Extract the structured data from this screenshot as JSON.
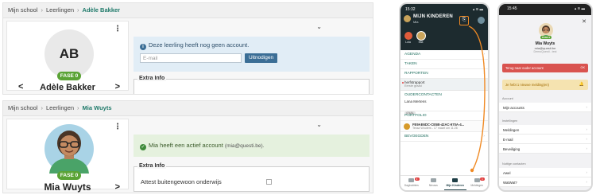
{
  "top_panel": {
    "breadcrumb": [
      "Mijn school",
      "Leerlingen",
      "Adèle Bakker"
    ],
    "initials": "AB",
    "fase": "FASE 0",
    "name": "Adèle Bakker",
    "prev": "<",
    "next": ">",
    "menu": "⋮",
    "collapse": "⌄",
    "alert_text": "Deze leerling heeft nog geen account.",
    "email_placeholder": "E-mail",
    "invite_label": "Uitnodigen",
    "extra_info": "Extra Info"
  },
  "bottom_panel": {
    "breadcrumb": [
      "Mijn school",
      "Leerlingen",
      "Mia Wuyts"
    ],
    "fase": "FASE 0",
    "name": "Mia Wuyts",
    "prev": "<",
    "next": ">",
    "menu": "⋮",
    "collapse": "⌄",
    "alert_text": "Mia heeft een actief account",
    "alert_email": "(mia@questi.be).",
    "extra_info": "Extra Info",
    "row_label": "Attest buitengewoon onderwijs"
  },
  "phone1": {
    "time": "15:32",
    "status": "▴ ≋ ▬",
    "title": "MIJN KINDEREN",
    "subtitle": "Mia",
    "edit_glyph": "⎘",
    "kids": [
      {
        "label": "Lola",
        "color": "#e15b3a"
      },
      {
        "label": "Mia",
        "color": "#c9a45b"
      }
    ],
    "chevron": "›",
    "items": [
      "AGENDA",
      "TAKEN",
      "RAPPORTEN"
    ],
    "report_item": {
      "title": "herfstrapport",
      "meta": "Eerste graad"
    },
    "contacts_header": "OUDERCONTACTEN",
    "contact_name": "Lana Mertens",
    "contact_tag": "4 NAL",
    "portfolio_header": "PORTFOLIO",
    "doc_title": "FE9AE6DC-CE5B-42AC-970A-4...",
    "doc_meta": "Tessa Wouters - 17 maart om 11:26",
    "bottom_item": "BEVOEGDEN",
    "tabs": [
      {
        "label": "Dagbubbles",
        "badge": "3"
      },
      {
        "label": "Nieuws",
        "badge": ""
      },
      {
        "label": "Mijn Kinderen",
        "badge": ""
      },
      {
        "label": "Meldingen",
        "badge": "1"
      }
    ]
  },
  "phone2": {
    "time": "15:45",
    "status": "▴ ≋ ▬",
    "close": "✕",
    "fase": "FASE 0",
    "name": "Mia Wuyts",
    "email": "mia@questi.be",
    "school": "DemoQuesti - test",
    "red_banner": "Terug naar ouder account",
    "red_badge": "OK",
    "yellow_banner": "Je hebt 1 nieuwe melding(en)",
    "bell": "🔔",
    "chevron": "›",
    "sections": [
      {
        "title": "Account",
        "rows": [
          "Mijn accounts"
        ]
      },
      {
        "title": "Instellingen",
        "rows": [
          "Meldingen",
          "E-mail",
          "Beveiliging"
        ]
      },
      {
        "title": "Nuttige contacten",
        "rows": [
          "Awel",
          "WatWat?"
        ]
      }
    ]
  },
  "colors": {
    "accent": "#1f7a6a",
    "fase_green": "#5aa335",
    "annotation_orange": "#f08a24",
    "alert_blue": "#e1edf6",
    "alert_green": "#e5f1de",
    "phone_dark": "#1d2b2f",
    "banner_red": "#d9534f",
    "banner_yellow": "#f5e3b0"
  }
}
